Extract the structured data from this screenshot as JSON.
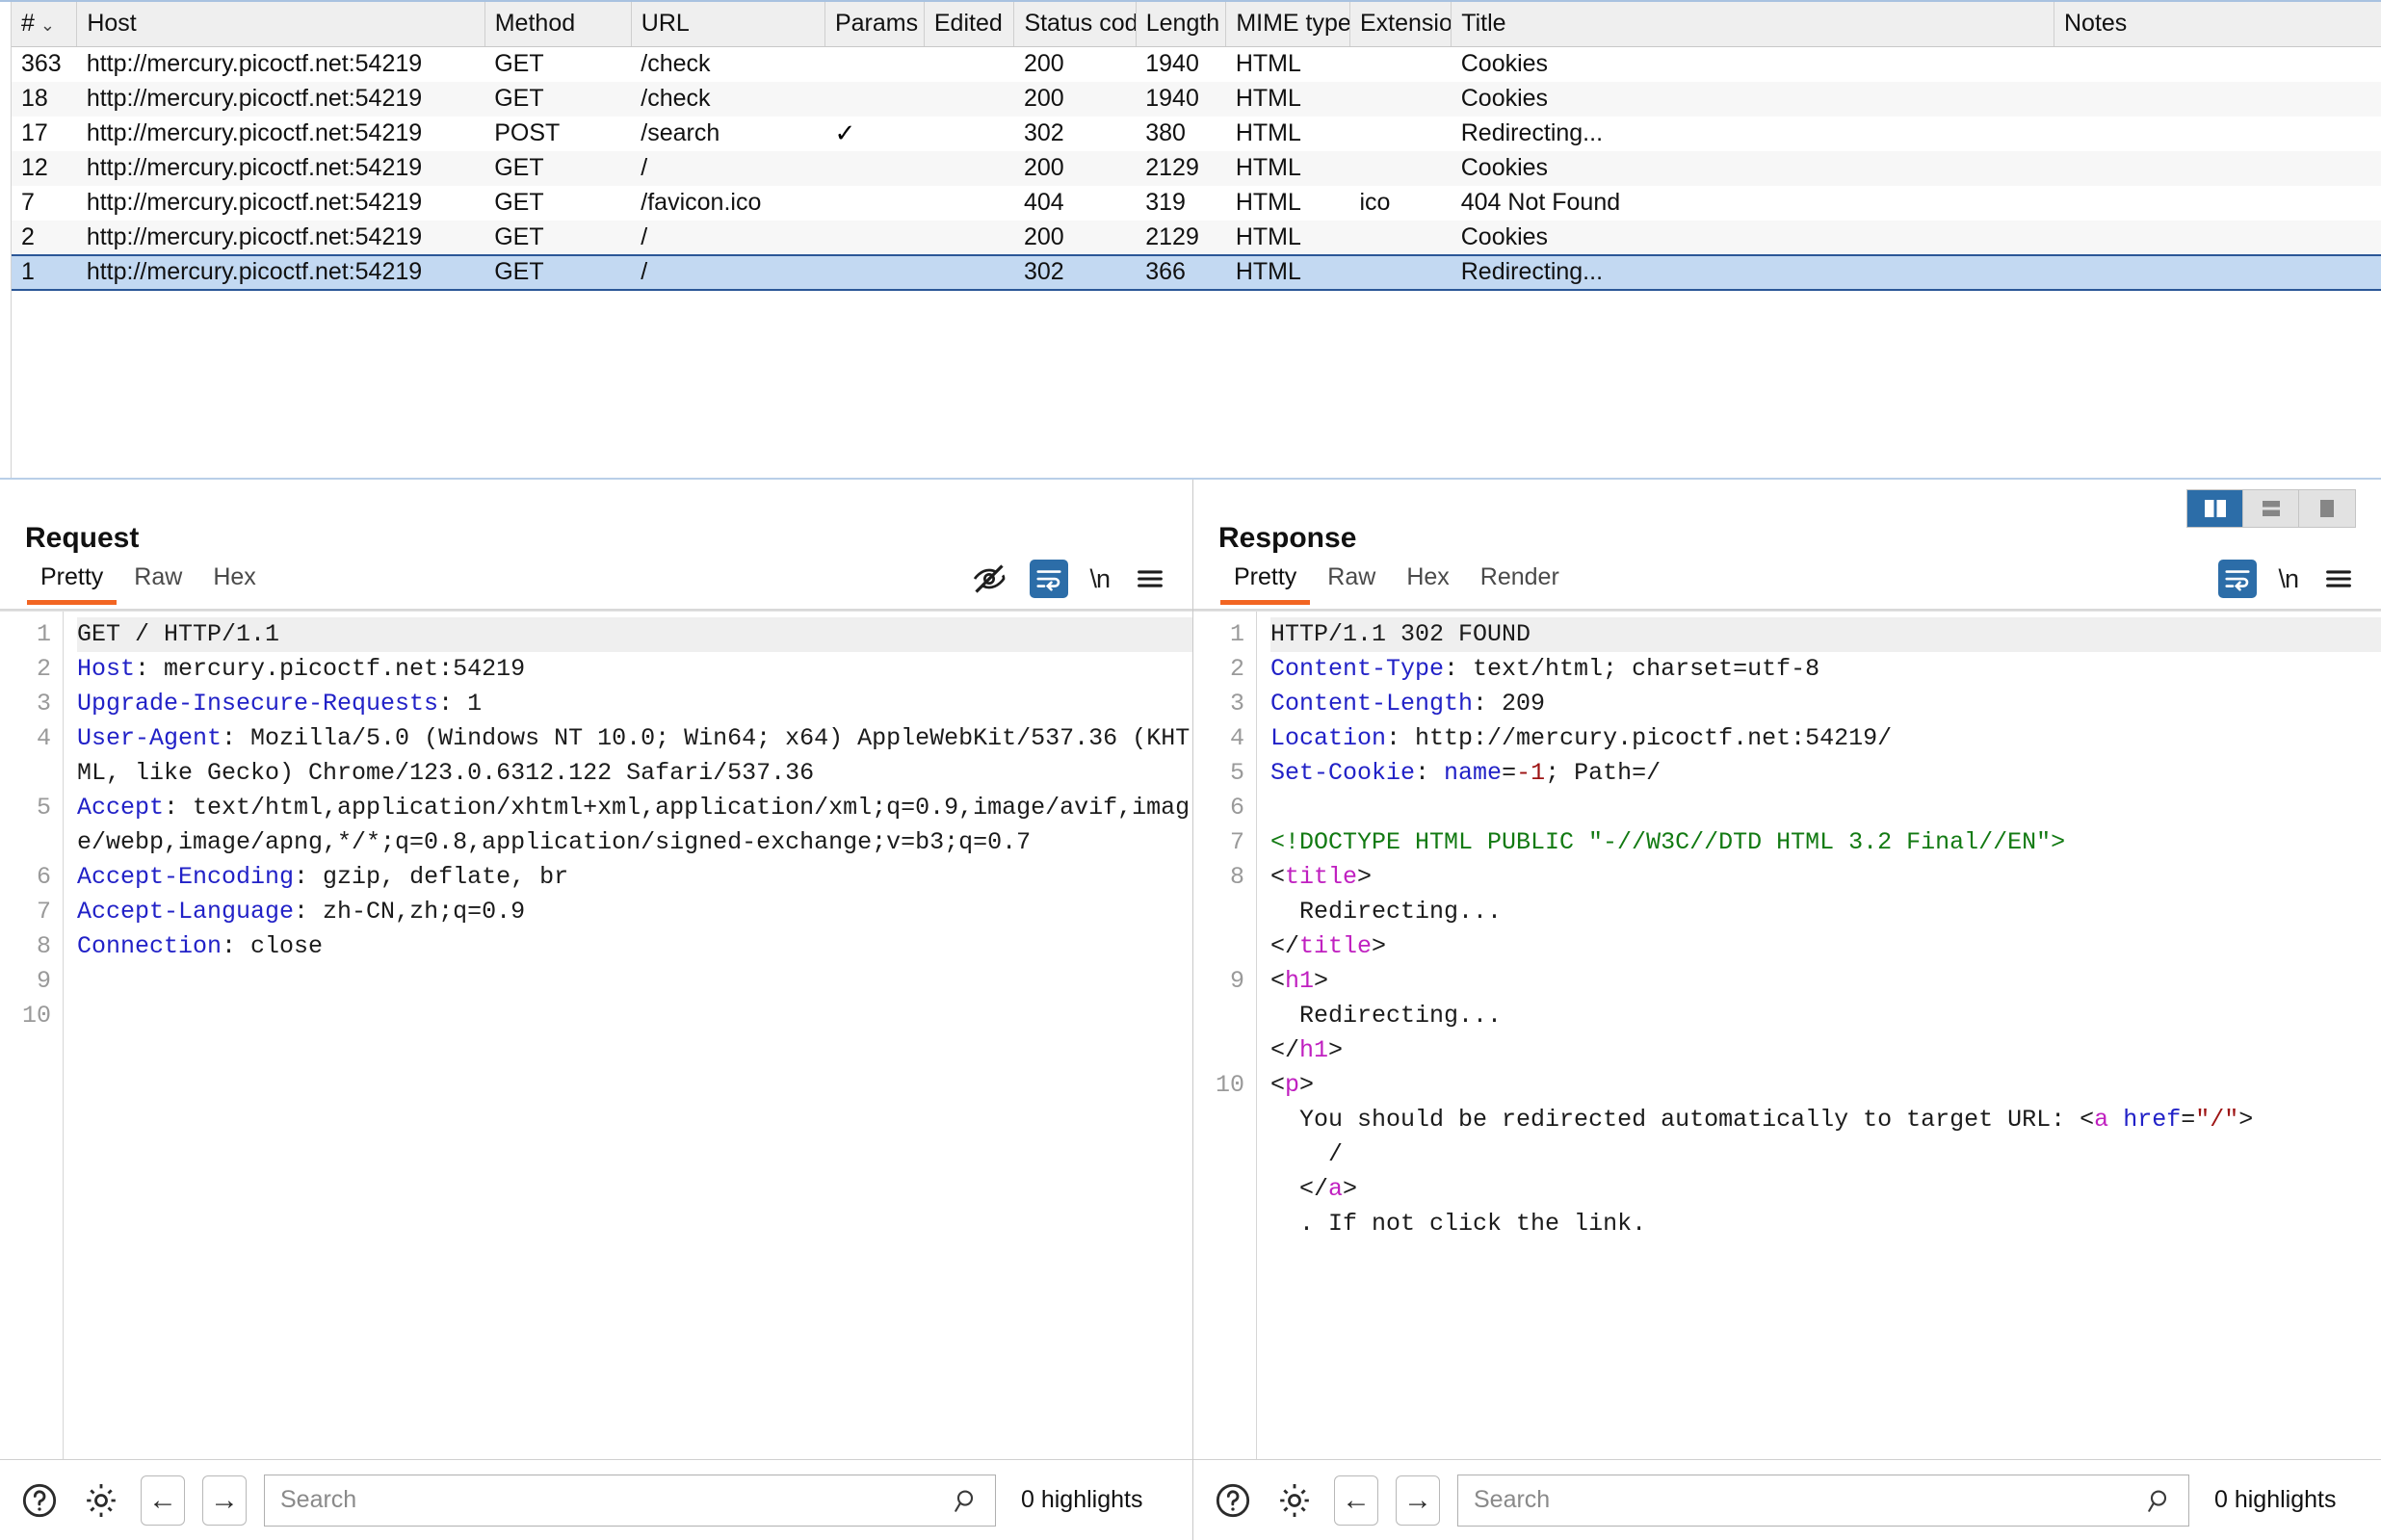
{
  "history": {
    "columns": [
      {
        "key": "num",
        "label": "#",
        "sorted": true,
        "caret": "⌄"
      },
      {
        "key": "host",
        "label": "Host"
      },
      {
        "key": "method",
        "label": "Method"
      },
      {
        "key": "url",
        "label": "URL"
      },
      {
        "key": "params",
        "label": "Params"
      },
      {
        "key": "edited",
        "label": "Edited"
      },
      {
        "key": "status",
        "label": "Status code"
      },
      {
        "key": "length",
        "label": "Length"
      },
      {
        "key": "mime",
        "label": "MIME type"
      },
      {
        "key": "ext",
        "label": "Extension"
      },
      {
        "key": "title",
        "label": "Title"
      },
      {
        "key": "notes",
        "label": "Notes"
      }
    ],
    "rows": [
      {
        "num": "363",
        "host": "http://mercury.picoctf.net:54219",
        "method": "GET",
        "url": "/check",
        "params": "",
        "edited": "",
        "status": "200",
        "length": "1940",
        "mime": "HTML",
        "ext": "",
        "title": "Cookies",
        "notes": "",
        "selected": false
      },
      {
        "num": "18",
        "host": "http://mercury.picoctf.net:54219",
        "method": "GET",
        "url": "/check",
        "params": "",
        "edited": "",
        "status": "200",
        "length": "1940",
        "mime": "HTML",
        "ext": "",
        "title": "Cookies",
        "notes": "",
        "selected": false
      },
      {
        "num": "17",
        "host": "http://mercury.picoctf.net:54219",
        "method": "POST",
        "url": "/search",
        "params": "✓",
        "edited": "",
        "status": "302",
        "length": "380",
        "mime": "HTML",
        "ext": "",
        "title": "Redirecting...",
        "notes": "",
        "selected": false
      },
      {
        "num": "12",
        "host": "http://mercury.picoctf.net:54219",
        "method": "GET",
        "url": "/",
        "params": "",
        "edited": "",
        "status": "200",
        "length": "2129",
        "mime": "HTML",
        "ext": "",
        "title": "Cookies",
        "notes": "",
        "selected": false
      },
      {
        "num": "7",
        "host": "http://mercury.picoctf.net:54219",
        "method": "GET",
        "url": "/favicon.ico",
        "params": "",
        "edited": "",
        "status": "404",
        "length": "319",
        "mime": "HTML",
        "ext": "ico",
        "title": "404 Not Found",
        "notes": "",
        "selected": false
      },
      {
        "num": "2",
        "host": "http://mercury.picoctf.net:54219",
        "method": "GET",
        "url": "/",
        "params": "",
        "edited": "",
        "status": "200",
        "length": "2129",
        "mime": "HTML",
        "ext": "",
        "title": "Cookies",
        "notes": "",
        "selected": false
      },
      {
        "num": "1",
        "host": "http://mercury.picoctf.net:54219",
        "method": "GET",
        "url": "/",
        "params": "",
        "edited": "",
        "status": "302",
        "length": "366",
        "mime": "HTML",
        "ext": "",
        "title": "Redirecting...",
        "notes": "",
        "selected": true
      }
    ]
  },
  "request": {
    "title": "Request",
    "tabs": [
      {
        "label": "Pretty",
        "active": true
      },
      {
        "label": "Raw",
        "active": false
      },
      {
        "label": "Hex",
        "active": false
      }
    ],
    "tools": [
      {
        "name": "hide-icon",
        "label": ""
      },
      {
        "name": "word-wrap-icon",
        "label": "",
        "active": true
      },
      {
        "name": "newline-icon",
        "label": "\\n"
      },
      {
        "name": "menu-icon",
        "label": ""
      }
    ],
    "line_numbers": [
      "1",
      "2",
      "3",
      "4",
      "5",
      "6",
      "7",
      "8",
      "9",
      "10"
    ],
    "lines": [
      {
        "n": "1",
        "first": true,
        "parts": [
          {
            "t": "GET / HTTP/1.1",
            "c": "val"
          }
        ]
      },
      {
        "n": "2",
        "parts": [
          {
            "t": "Host",
            "c": "hdr"
          },
          {
            "t": ": mercury.picoctf.net:54219",
            "c": "val"
          }
        ]
      },
      {
        "n": "3",
        "parts": [
          {
            "t": "Upgrade-Insecure-Requests",
            "c": "hdr"
          },
          {
            "t": ": 1",
            "c": "val"
          }
        ]
      },
      {
        "n": "4",
        "parts": [
          {
            "t": "User-Agent",
            "c": "hdr"
          },
          {
            "t": ": Mozilla/5.0 (Windows NT 10.0; Win64; x64) AppleWebKit/537.36 (KHTML, like Gecko) Chrome/123.0.6312.122 Safari/537.36",
            "c": "val"
          }
        ]
      },
      {
        "n": "5",
        "parts": [
          {
            "t": "Accept",
            "c": "hdr"
          },
          {
            "t": ": text/html,application/xhtml+xml,application/xml;q=0.9,image/avif,image/webp,image/apng,*/*;q=0.8,application/signed-exchange;v=b3;q=0.7",
            "c": "val"
          }
        ]
      },
      {
        "n": "6",
        "parts": [
          {
            "t": "Accept-Encoding",
            "c": "hdr"
          },
          {
            "t": ": gzip, deflate, br",
            "c": "val"
          }
        ]
      },
      {
        "n": "7",
        "parts": [
          {
            "t": "Accept-Language",
            "c": "hdr"
          },
          {
            "t": ": zh-CN,zh;q=0.9",
            "c": "val"
          }
        ]
      },
      {
        "n": "8",
        "parts": [
          {
            "t": "Connection",
            "c": "hdr"
          },
          {
            "t": ": close",
            "c": "val"
          }
        ]
      },
      {
        "n": "9",
        "parts": [
          {
            "t": "",
            "c": "val"
          }
        ]
      },
      {
        "n": "10",
        "parts": [
          {
            "t": "",
            "c": "val"
          }
        ]
      }
    ],
    "search": {
      "placeholder": "Search",
      "value": "",
      "highlights": "0 highlights"
    }
  },
  "response": {
    "title": "Response",
    "tabs": [
      {
        "label": "Pretty",
        "active": true
      },
      {
        "label": "Raw",
        "active": false
      },
      {
        "label": "Hex",
        "active": false
      },
      {
        "label": "Render",
        "active": false
      }
    ],
    "tools": [
      {
        "name": "word-wrap-icon",
        "label": "",
        "active": true
      },
      {
        "name": "newline-icon",
        "label": "\\n"
      },
      {
        "name": "menu-icon",
        "label": ""
      }
    ],
    "view_modes": [
      {
        "name": "side-by-side-view",
        "active": true
      },
      {
        "name": "stacked-view",
        "active": false
      },
      {
        "name": "single-view",
        "active": false
      }
    ],
    "lines": [
      {
        "n": "1",
        "first": true,
        "parts": [
          {
            "t": "HTTP/1.1 302 FOUND",
            "c": "val"
          }
        ]
      },
      {
        "n": "2",
        "parts": [
          {
            "t": "Content-Type",
            "c": "hdr"
          },
          {
            "t": ": text/html; charset=utf-8",
            "c": "val"
          }
        ]
      },
      {
        "n": "3",
        "parts": [
          {
            "t": "Content-Length",
            "c": "hdr"
          },
          {
            "t": ": 209",
            "c": "val"
          }
        ]
      },
      {
        "n": "4",
        "parts": [
          {
            "t": "Location",
            "c": "hdr"
          },
          {
            "t": ": http://mercury.picoctf.net:54219/",
            "c": "val"
          }
        ]
      },
      {
        "n": "5",
        "parts": [
          {
            "t": "Set-Cookie",
            "c": "hdr"
          },
          {
            "t": ": ",
            "c": "val"
          },
          {
            "t": "name",
            "c": "attr"
          },
          {
            "t": "=",
            "c": "val"
          },
          {
            "t": "-1",
            "c": "num"
          },
          {
            "t": "; Path=/",
            "c": "val"
          }
        ]
      },
      {
        "n": "6",
        "parts": [
          {
            "t": "",
            "c": "val"
          }
        ]
      },
      {
        "n": "7",
        "parts": [
          {
            "t": "<!DOCTYPE HTML PUBLIC \"-//W3C//DTD HTML 3.2 Final//EN\">",
            "c": "doct"
          }
        ]
      },
      {
        "n": "8",
        "parts": [
          {
            "t": "<",
            "c": "brk"
          },
          {
            "t": "title",
            "c": "tag"
          },
          {
            "t": ">",
            "c": "brk"
          },
          {
            "t": "\n  Redirecting...\n",
            "c": "val"
          },
          {
            "t": "</",
            "c": "brk"
          },
          {
            "t": "title",
            "c": "tag"
          },
          {
            "t": ">",
            "c": "brk"
          }
        ]
      },
      {
        "n": "9",
        "parts": [
          {
            "t": "<",
            "c": "brk"
          },
          {
            "t": "h1",
            "c": "tag"
          },
          {
            "t": ">",
            "c": "brk"
          },
          {
            "t": "\n  Redirecting...\n",
            "c": "val"
          },
          {
            "t": "</",
            "c": "brk"
          },
          {
            "t": "h1",
            "c": "tag"
          },
          {
            "t": ">",
            "c": "brk"
          }
        ]
      },
      {
        "n": "10",
        "parts": [
          {
            "t": "<",
            "c": "brk"
          },
          {
            "t": "p",
            "c": "tag"
          },
          {
            "t": ">",
            "c": "brk"
          },
          {
            "t": "\n  You should be redirected automatically to target URL: ",
            "c": "val"
          },
          {
            "t": "<",
            "c": "brk"
          },
          {
            "t": "a",
            "c": "tag"
          },
          {
            "t": " ",
            "c": "val"
          },
          {
            "t": "href",
            "c": "attr"
          },
          {
            "t": "=",
            "c": "val"
          },
          {
            "t": "\"/\"",
            "c": "str"
          },
          {
            "t": ">",
            "c": "brk"
          },
          {
            "t": "\n    /\n  ",
            "c": "val"
          },
          {
            "t": "</",
            "c": "brk"
          },
          {
            "t": "a",
            "c": "tag"
          },
          {
            "t": ">",
            "c": "brk"
          },
          {
            "t": "\n  . If not click the link.",
            "c": "val"
          }
        ]
      }
    ],
    "search": {
      "placeholder": "Search",
      "value": "",
      "highlights": "0 highlights"
    }
  }
}
